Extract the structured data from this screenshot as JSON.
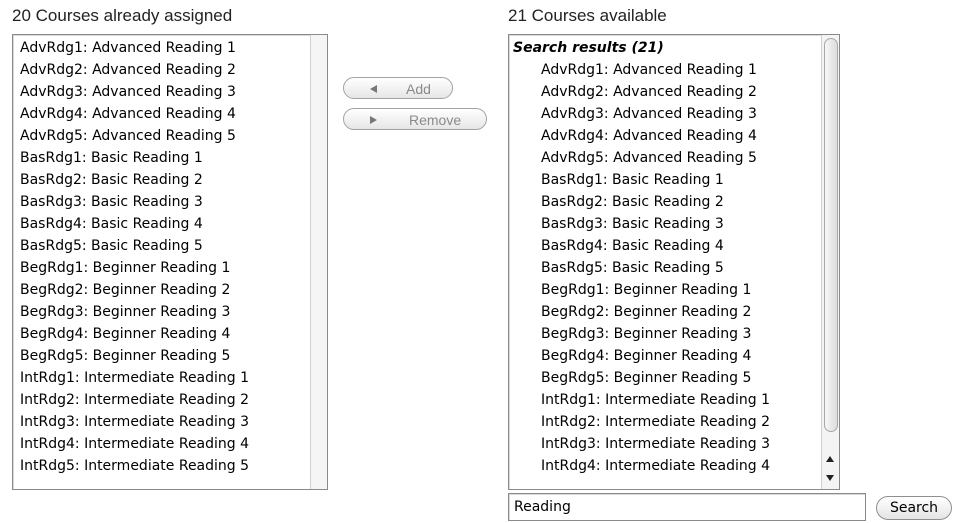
{
  "assigned": {
    "heading": "20 Courses already assigned",
    "items": [
      "AdvRdg1: Advanced Reading 1",
      "AdvRdg2: Advanced Reading 2",
      "AdvRdg3: Advanced Reading 3",
      "AdvRdg4: Advanced Reading 4",
      "AdvRdg5: Advanced Reading 5",
      "BasRdg1: Basic Reading 1",
      "BasRdg2: Basic Reading 2",
      "BasRdg3: Basic Reading 3",
      "BasRdg4: Basic Reading 4",
      "BasRdg5: Basic Reading 5",
      "BegRdg1: Beginner Reading 1",
      "BegRdg2: Beginner Reading 2",
      "BegRdg3: Beginner Reading 3",
      "BegRdg4: Beginner Reading 4",
      "BegRdg5: Beginner Reading 5",
      "IntRdg1: Intermediate Reading 1",
      "IntRdg2: Intermediate Reading 2",
      "IntRdg3: Intermediate Reading 3",
      "IntRdg4: Intermediate Reading 4",
      "IntRdg5: Intermediate Reading 5"
    ]
  },
  "actions": {
    "add_label": "Add",
    "remove_label": "Remove"
  },
  "available": {
    "heading": "21 Courses available",
    "group_label": "Search results (21)",
    "items": [
      "AdvRdg1: Advanced Reading 1",
      "AdvRdg2: Advanced Reading 2",
      "AdvRdg3: Advanced Reading 3",
      "AdvRdg4: Advanced Reading 4",
      "AdvRdg5: Advanced Reading 5",
      "BasRdg1: Basic Reading 1",
      "BasRdg2: Basic Reading 2",
      "BasRdg3: Basic Reading 3",
      "BasRdg4: Basic Reading 4",
      "BasRdg5: Basic Reading 5",
      "BegRdg1: Beginner Reading 1",
      "BegRdg2: Beginner Reading 2",
      "BegRdg3: Beginner Reading 3",
      "BegRdg4: Beginner Reading 4",
      "BegRdg5: Beginner Reading 5",
      "IntRdg1: Intermediate Reading 1",
      "IntRdg2: Intermediate Reading 2",
      "IntRdg3: Intermediate Reading 3",
      "IntRdg4: Intermediate Reading 4"
    ]
  },
  "search": {
    "value": "Reading",
    "button_label": "Search"
  },
  "icons": {
    "add": "left-arrow-icon",
    "remove": "right-arrow-icon",
    "scroll_up": "scroll-up-arrow-icon",
    "scroll_down": "scroll-down-arrow-icon"
  }
}
